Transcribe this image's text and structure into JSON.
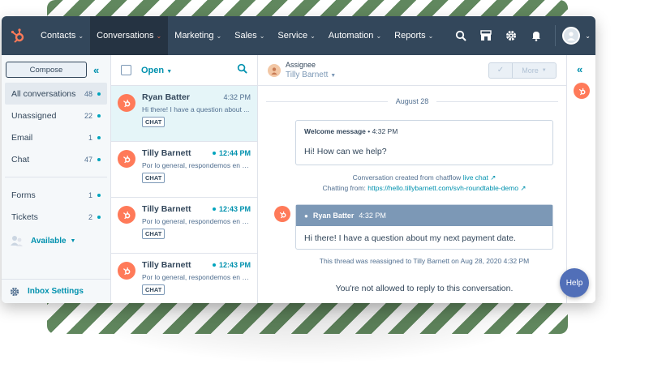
{
  "nav": {
    "items": [
      {
        "label": "Contacts",
        "active": false
      },
      {
        "label": "Conversations",
        "active": true
      },
      {
        "label": "Marketing",
        "active": false
      },
      {
        "label": "Sales",
        "active": false
      },
      {
        "label": "Service",
        "active": false
      },
      {
        "label": "Automation",
        "active": false
      },
      {
        "label": "Reports",
        "active": false
      }
    ],
    "icons": [
      "search-icon",
      "marketplace-icon",
      "gear-icon",
      "bell-icon"
    ]
  },
  "sidebar": {
    "compose_label": "Compose",
    "items": [
      {
        "label": "All conversations",
        "count": "48",
        "active": true
      },
      {
        "label": "Unassigned",
        "count": "22",
        "active": false
      },
      {
        "label": "Email",
        "count": "1",
        "active": false
      },
      {
        "label": "Chat",
        "count": "47",
        "active": false
      }
    ],
    "items2": [
      {
        "label": "Forms",
        "count": "1"
      },
      {
        "label": "Tickets",
        "count": "2"
      }
    ],
    "availability": "Available",
    "settings_label": "Inbox Settings"
  },
  "list": {
    "filter": "Open",
    "conversations": [
      {
        "name": "Ryan Batter",
        "time": "4:32 PM",
        "preview": "Hi there! I have a question about ...",
        "badge": "CHAT",
        "unread": false,
        "selected": true
      },
      {
        "name": "Tilly Barnett",
        "time": "12:44 PM",
        "preview": "Por lo general, respondemos en u...",
        "badge": "CHAT",
        "unread": true,
        "selected": false
      },
      {
        "name": "Tilly Barnett",
        "time": "12:43 PM",
        "preview": "Por lo general, respondemos en u...",
        "badge": "CHAT",
        "unread": true,
        "selected": false
      },
      {
        "name": "Tilly Barnett",
        "time": "12:43 PM",
        "preview": "Por lo general, respondemos en u...",
        "badge": "CHAT",
        "unread": true,
        "selected": false
      }
    ]
  },
  "thread": {
    "assignee_label": "Assignee",
    "assignee_name": "Tilly Barnett",
    "more_label": "More",
    "date": "August 28",
    "welcome_title": "Welcome message",
    "welcome_time": "4:32 PM",
    "welcome_text": "Hi! How can we help?",
    "created_prefix": "Conversation created from chatflow",
    "created_link": "live chat",
    "chatting_prefix": "Chatting from:",
    "chatting_link": "https://hello.tillybarnett.com/svh-roundtable-demo",
    "visitor_name": "Ryan Batter",
    "visitor_time": "4:32 PM",
    "visitor_text": "Hi there! I have a question about my next payment date.",
    "reassign_text": "This thread was reassigned to Tilly Barnett on Aug 28, 2020 4:32 PM",
    "noreply_text": "You're not allowed to reply to this conversation."
  },
  "help_label": "Help",
  "colors": {
    "nav_bg": "#33475b",
    "accent_orange": "#ff7a59",
    "link_teal": "#0091ae",
    "help_bg": "#516fb8"
  }
}
